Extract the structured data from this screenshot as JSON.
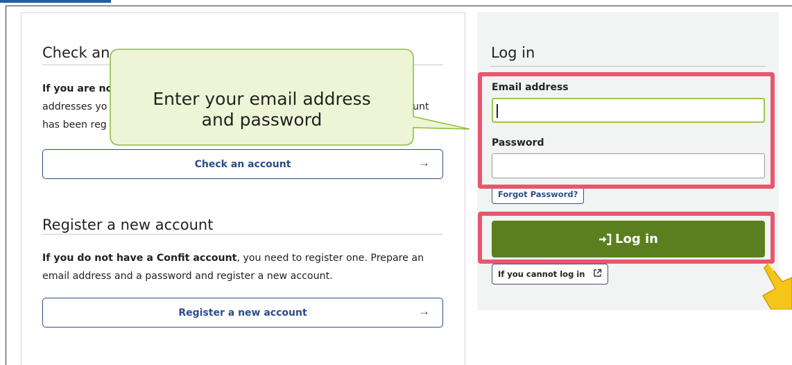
{
  "check_section": {
    "title": "Check an account",
    "title_visible": "Check an",
    "para_bold_visible": "If you are no",
    "para_line2_start": "addresses yo",
    "para_line2_end": "unt",
    "para_line3_start": "has been reg",
    "button_label": "Check an account",
    "arrow": "→"
  },
  "register_section": {
    "title": "Register a new account",
    "para_bold": "If you do not have a Confit account",
    "para_rest_1": ", you need to register one. Prepare an",
    "para_line2": "email address and a password and register a new account.",
    "button_label": "Register a new account",
    "arrow": "→"
  },
  "login": {
    "title": "Log in",
    "email_label": "Email address",
    "email_value": "",
    "password_label": "Password",
    "password_value": "",
    "forgot_label": "Forgot Password?",
    "login_button": "Log in",
    "cannot_login_label": "If you cannot log in"
  },
  "callout": {
    "line1": "Enter your email address",
    "line2": "and password"
  },
  "colors": {
    "highlight": "#e8566e",
    "login_green": "#5b7f1f",
    "callout_fill": "#edf5d6",
    "callout_border": "#8fbf3f",
    "link_blue": "#2b4c8a"
  },
  "icons": {
    "login_icon": "sign-in-icon",
    "external_icon": "external-link-icon",
    "pointer_icon": "pointing-hand-icon"
  }
}
